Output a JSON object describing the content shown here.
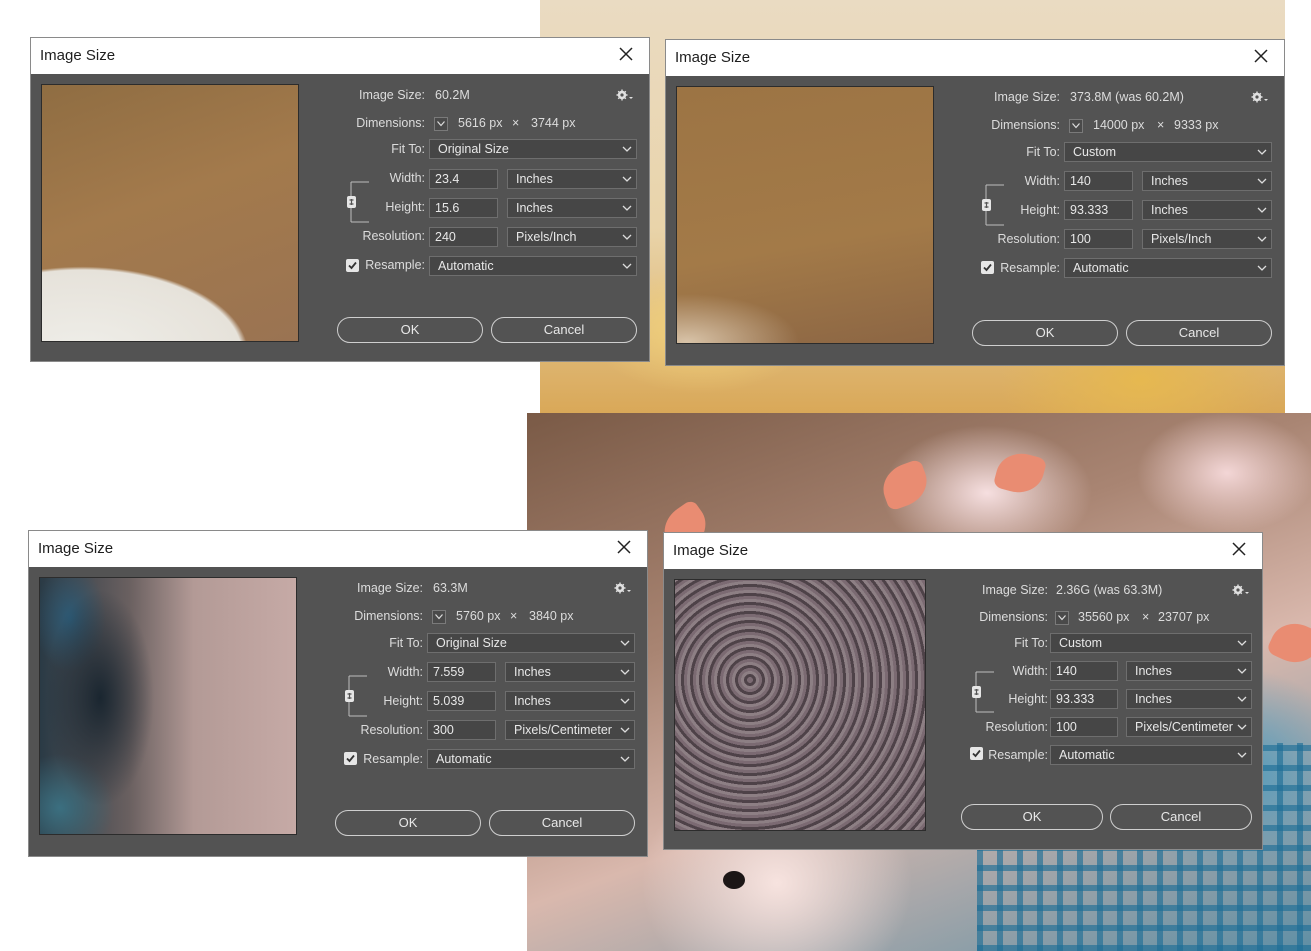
{
  "labels": {
    "image_size": "Image Size:",
    "dimensions": "Dimensions:",
    "fit_to": "Fit To:",
    "width": "Width:",
    "height": "Height:",
    "resolution": "Resolution:",
    "resample": "Resample:",
    "times": "×"
  },
  "dialogs": [
    {
      "title": "Image Size",
      "image_size": "60.2M",
      "dim_w": "5616 px",
      "dim_h": "3744 px",
      "fit_to": "Original Size",
      "width": "23.4",
      "width_unit": "Inches",
      "height": "15.6",
      "height_unit": "Inches",
      "resolution": "240",
      "resolution_unit": "Pixels/Inch",
      "resample": "Automatic",
      "resample_checked": true,
      "ok": "OK",
      "cancel": "Cancel"
    },
    {
      "title": "Image Size",
      "image_size": "373.8M (was 60.2M)",
      "dim_w": "14000 px",
      "dim_h": "9333 px",
      "fit_to": "Custom",
      "width": "140",
      "width_unit": "Inches",
      "height": "93.333",
      "height_unit": "Inches",
      "resolution": "100",
      "resolution_unit": "Pixels/Inch",
      "resample": "Automatic",
      "resample_checked": true,
      "ok": "OK",
      "cancel": "Cancel"
    },
    {
      "title": "Image Size",
      "image_size": "63.3M",
      "dim_w": "5760 px",
      "dim_h": "3840 px",
      "fit_to": "Original Size",
      "width": "7.559",
      "width_unit": "Inches",
      "height": "5.039",
      "height_unit": "Inches",
      "resolution": "300",
      "resolution_unit": "Pixels/Centimeter",
      "resample": "Automatic",
      "resample_checked": true,
      "ok": "OK",
      "cancel": "Cancel"
    },
    {
      "title": "Image Size",
      "image_size": "2.36G (was 63.3M)",
      "dim_w": "35560 px",
      "dim_h": "23707 px",
      "fit_to": "Custom",
      "width": "140",
      "width_unit": "Inches",
      "height": "93.333",
      "height_unit": "Inches",
      "resolution": "100",
      "resolution_unit": "Pixels/Centimeter",
      "resample": "Automatic",
      "resample_checked": true,
      "ok": "OK",
      "cancel": "Cancel"
    }
  ],
  "colors": {
    "dialog_bg": "#535353",
    "field_bg": "#464646",
    "title_bar": "#ffffff"
  },
  "icons": [
    "close-icon",
    "gear-icon",
    "chevron-down-icon",
    "link-chain-icon",
    "checkmark-icon"
  ]
}
